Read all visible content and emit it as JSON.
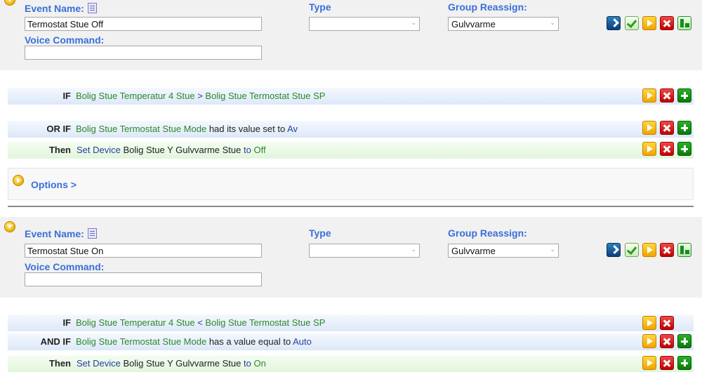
{
  "events": [
    {
      "labels": {
        "event_name": "Event Name:",
        "type": "Type",
        "group_reassign": "Group Reassign:",
        "voice_command": "Voice Command:"
      },
      "event_name_value": "Termostat Stue Off",
      "type_value": "",
      "group_value": "Gulvvarme",
      "voice_value": "",
      "rows": [
        {
          "kind": "condition",
          "keyword": "IF",
          "parts": [
            {
              "t": "Bolig Stue Temperatur 4 Stue",
              "c": "g"
            },
            {
              "t": " > ",
              "c": "b"
            },
            {
              "t": "Bolig Stue Termostat Stue SP",
              "c": "g"
            }
          ],
          "buttons": [
            "play",
            "delete",
            "add"
          ]
        },
        {
          "kind": "condition",
          "keyword": "OR IF",
          "parts": [
            {
              "t": "Bolig Stue Termostat Stue Mode",
              "c": "g"
            },
            {
              "t": " had its value set to ",
              "c": "k"
            },
            {
              "t": "Av",
              "c": "b"
            }
          ],
          "buttons": [
            "play",
            "delete",
            "add"
          ]
        },
        {
          "kind": "action",
          "keyword": "Then",
          "parts": [
            {
              "t": "Set Device",
              "c": "b"
            },
            {
              "t": " Bolig Stue Y Gulvvarme Stue ",
              "c": "k"
            },
            {
              "t": "to",
              "c": "b"
            },
            {
              "t": " Off",
              "c": "g"
            }
          ],
          "buttons": [
            "play",
            "delete",
            "add"
          ]
        }
      ],
      "options_label": "Options >"
    },
    {
      "labels": {
        "event_name": "Event Name:",
        "type": "Type",
        "group_reassign": "Group Reassign:",
        "voice_command": "Voice Command:"
      },
      "event_name_value": "Termostat Stue On",
      "type_value": "",
      "group_value": "Gulvvarme",
      "voice_value": "",
      "rows": [
        {
          "kind": "condition",
          "keyword": "IF",
          "parts": [
            {
              "t": "Bolig Stue Temperatur 4 Stue",
              "c": "g"
            },
            {
              "t": " < ",
              "c": "b"
            },
            {
              "t": "Bolig Stue Termostat Stue SP",
              "c": "g"
            }
          ],
          "buttons": [
            "play",
            "delete"
          ]
        },
        {
          "kind": "condition",
          "keyword": "AND IF",
          "parts": [
            {
              "t": "Bolig Stue Termostat Stue Mode",
              "c": "g"
            },
            {
              "t": " has a value equal to ",
              "c": "k"
            },
            {
              "t": "Auto",
              "c": "b"
            }
          ],
          "buttons": [
            "play",
            "delete",
            "add"
          ]
        },
        {
          "kind": "action",
          "keyword": "Then",
          "parts": [
            {
              "t": "Set Device",
              "c": "b"
            },
            {
              "t": " Bolig Stue Y Gulvvarme Stue ",
              "c": "k"
            },
            {
              "t": "to",
              "c": "b"
            },
            {
              "t": " On",
              "c": "g"
            }
          ],
          "buttons": [
            "play",
            "delete",
            "add"
          ]
        }
      ]
    }
  ],
  "header_buttons": [
    "run",
    "save",
    "test",
    "delete",
    "group"
  ],
  "icons": {
    "collapse": "collapse-toggle-icon",
    "notes": "notes-icon",
    "options": "options-expand-icon"
  },
  "colors": {
    "label_blue": "#3a6fd8",
    "device_green": "#2a8a2a",
    "operator_blue": "#2840a0",
    "condition_row": "#dde8f8",
    "action_row": "#e2f5dc"
  }
}
